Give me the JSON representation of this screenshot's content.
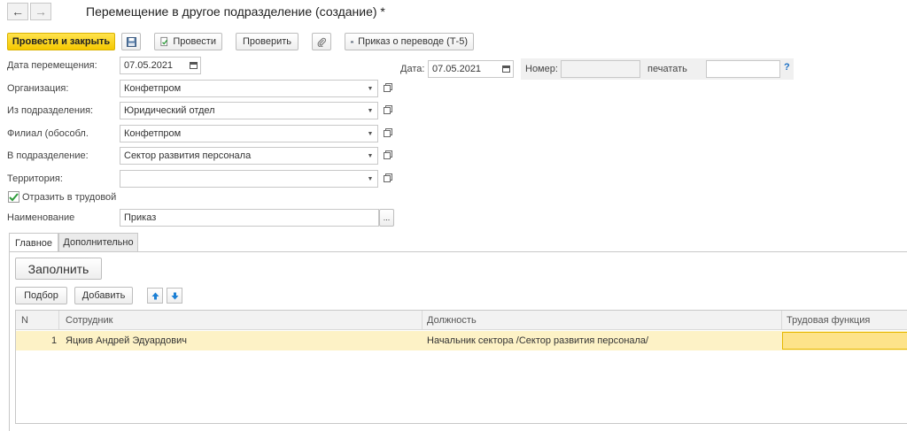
{
  "header": {
    "back_icon": "arrow-left-icon",
    "forward_icon": "arrow-right-icon",
    "title": "Перемещение в другое подразделение (создание) *"
  },
  "toolbar": {
    "post_close_label": "Провести и закрыть",
    "save_icon": "floppy-disk-icon",
    "post_label": "Провести",
    "check_label": "Проверить",
    "attach_icon": "paperclip-icon",
    "print_label": "Приказ о переводе (Т-5)"
  },
  "form": {
    "move_date_label": "Дата перемещения:",
    "move_date_value": "07.05.2021",
    "date_label": "Дата:",
    "date_value": "07.05.2021",
    "number_label": "Номер:",
    "number_value": "",
    "print_label": "печатать",
    "print_value": "",
    "help": "?",
    "org_label": "Организация:",
    "org_value": "Конфетпром",
    "from_dept_label": "Из подразделения:",
    "from_dept_value": "Юридический отдел",
    "branch_label": "Филиал (обособл.",
    "branch_value": "Конфетпром",
    "to_dept_label": "В подразделение:",
    "to_dept_value": "Сектор развития персонала",
    "territory_label": "Территория:",
    "territory_value": "",
    "labor_checkbox_label": "Отразить в трудовой",
    "labor_checked": true,
    "name_label": "Наименование",
    "name_value": "Приказ"
  },
  "tabs": [
    {
      "label": "Главное",
      "active": true
    },
    {
      "label": "Дополнительно",
      "active": false
    }
  ],
  "main": {
    "fill_label": "Заполнить",
    "select_label": "Подбор",
    "add_label": "Добавить"
  },
  "table": {
    "columns": [
      "N",
      "Сотрудник",
      "Должность",
      "Трудовая функция"
    ],
    "rows": [
      {
        "n": "1",
        "employee": "Яцкив Андрей Эдуардович",
        "position": "Начальник сектора /Сектор развития персонала/",
        "labor_function": ""
      }
    ]
  },
  "colors": {
    "primary_button": "#f5c800",
    "selected_row": "#fdf2c6",
    "selected_cell": "#fde38a"
  }
}
